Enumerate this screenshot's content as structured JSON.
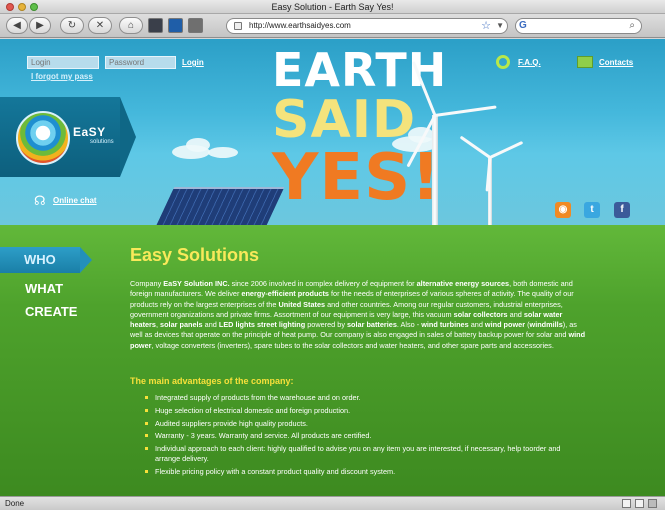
{
  "window": {
    "title": "Easy Solution - Earth Say Yes!"
  },
  "toolbar": {
    "back_icon": "back-arrow-icon",
    "forward_icon": "forward-arrow-icon",
    "reload_glyph": "↻",
    "stop_glyph": "✕",
    "home_glyph": "⌂",
    "url": "http://www.earthsaidyes.com",
    "search_engine": "G"
  },
  "header": {
    "login_placeholder": "Login",
    "password_placeholder": "Password",
    "login_link": "Login",
    "forgot_link": "I forgot my pass",
    "faq_link": "F.A.Q.",
    "contacts_link": "Contacts",
    "chat_link": "Online chat",
    "logo_text": "EaSY",
    "logo_sub": "solutions",
    "headline": [
      "EARTH",
      "SAID",
      "YES!"
    ],
    "social": [
      {
        "name": "rss",
        "glyph": "◉",
        "color": "#f08a24"
      },
      {
        "name": "twitter",
        "glyph": "t",
        "color": "#3aa7e0"
      },
      {
        "name": "facebook",
        "glyph": "f",
        "color": "#3b5b9a"
      }
    ]
  },
  "sidebar": {
    "items": [
      "WHO",
      "WHAT",
      "CREATE"
    ]
  },
  "main": {
    "title": "Easy Solutions",
    "paragraph_html": "Company <b>EaSY Solution INC.</b> since 2006 involved in complex delivery of equipment for <b>alternative energy sources</b>, both domestic and foreign manufacturers. We deliver <b>energy-efficient products</b> for the needs of enterprises of various spheres of activity. The quality of our products rely on the largest enterprises of the <b>United States</b> and other countries. Among our regular customers, industrial enterprises, government organizations and private firms. Assortment of our equipment is very large, this vacuum <b>solar collectors</b> and <b>solar water heaters</b>, <b>solar panels</b> and <b>LED lights street lighting</b> powered by <b>solar batteries</b>. Also - <b>wind turbines</b> and <b>wind power</b> (<b>windmills</b>), as well as devices that operate on the principle of heat pump. Our company is also engaged in sales of battery backup power for solar and <b>wind power</b>, voltage converters (inverters), spare tubes to the solar collectors and water heaters, and other spare parts and accessories.",
    "advantages_title": "The main advantages of the company:",
    "advantages": [
      "Integrated supply of products from the warehouse and on order.",
      "Huge selection of electrical domestic and foreign production.",
      "Audited suppliers provide high quality products.",
      "Warranty - 3 years. Warranty and service. All products are certified.",
      "Individual approach to each client: highly qualified to advise you on any item you are interested, if necessary, help toorder and arrange delivery.",
      "Flexible pricing policy with a constant product quality and discount system."
    ]
  },
  "status": {
    "text": "Done"
  }
}
